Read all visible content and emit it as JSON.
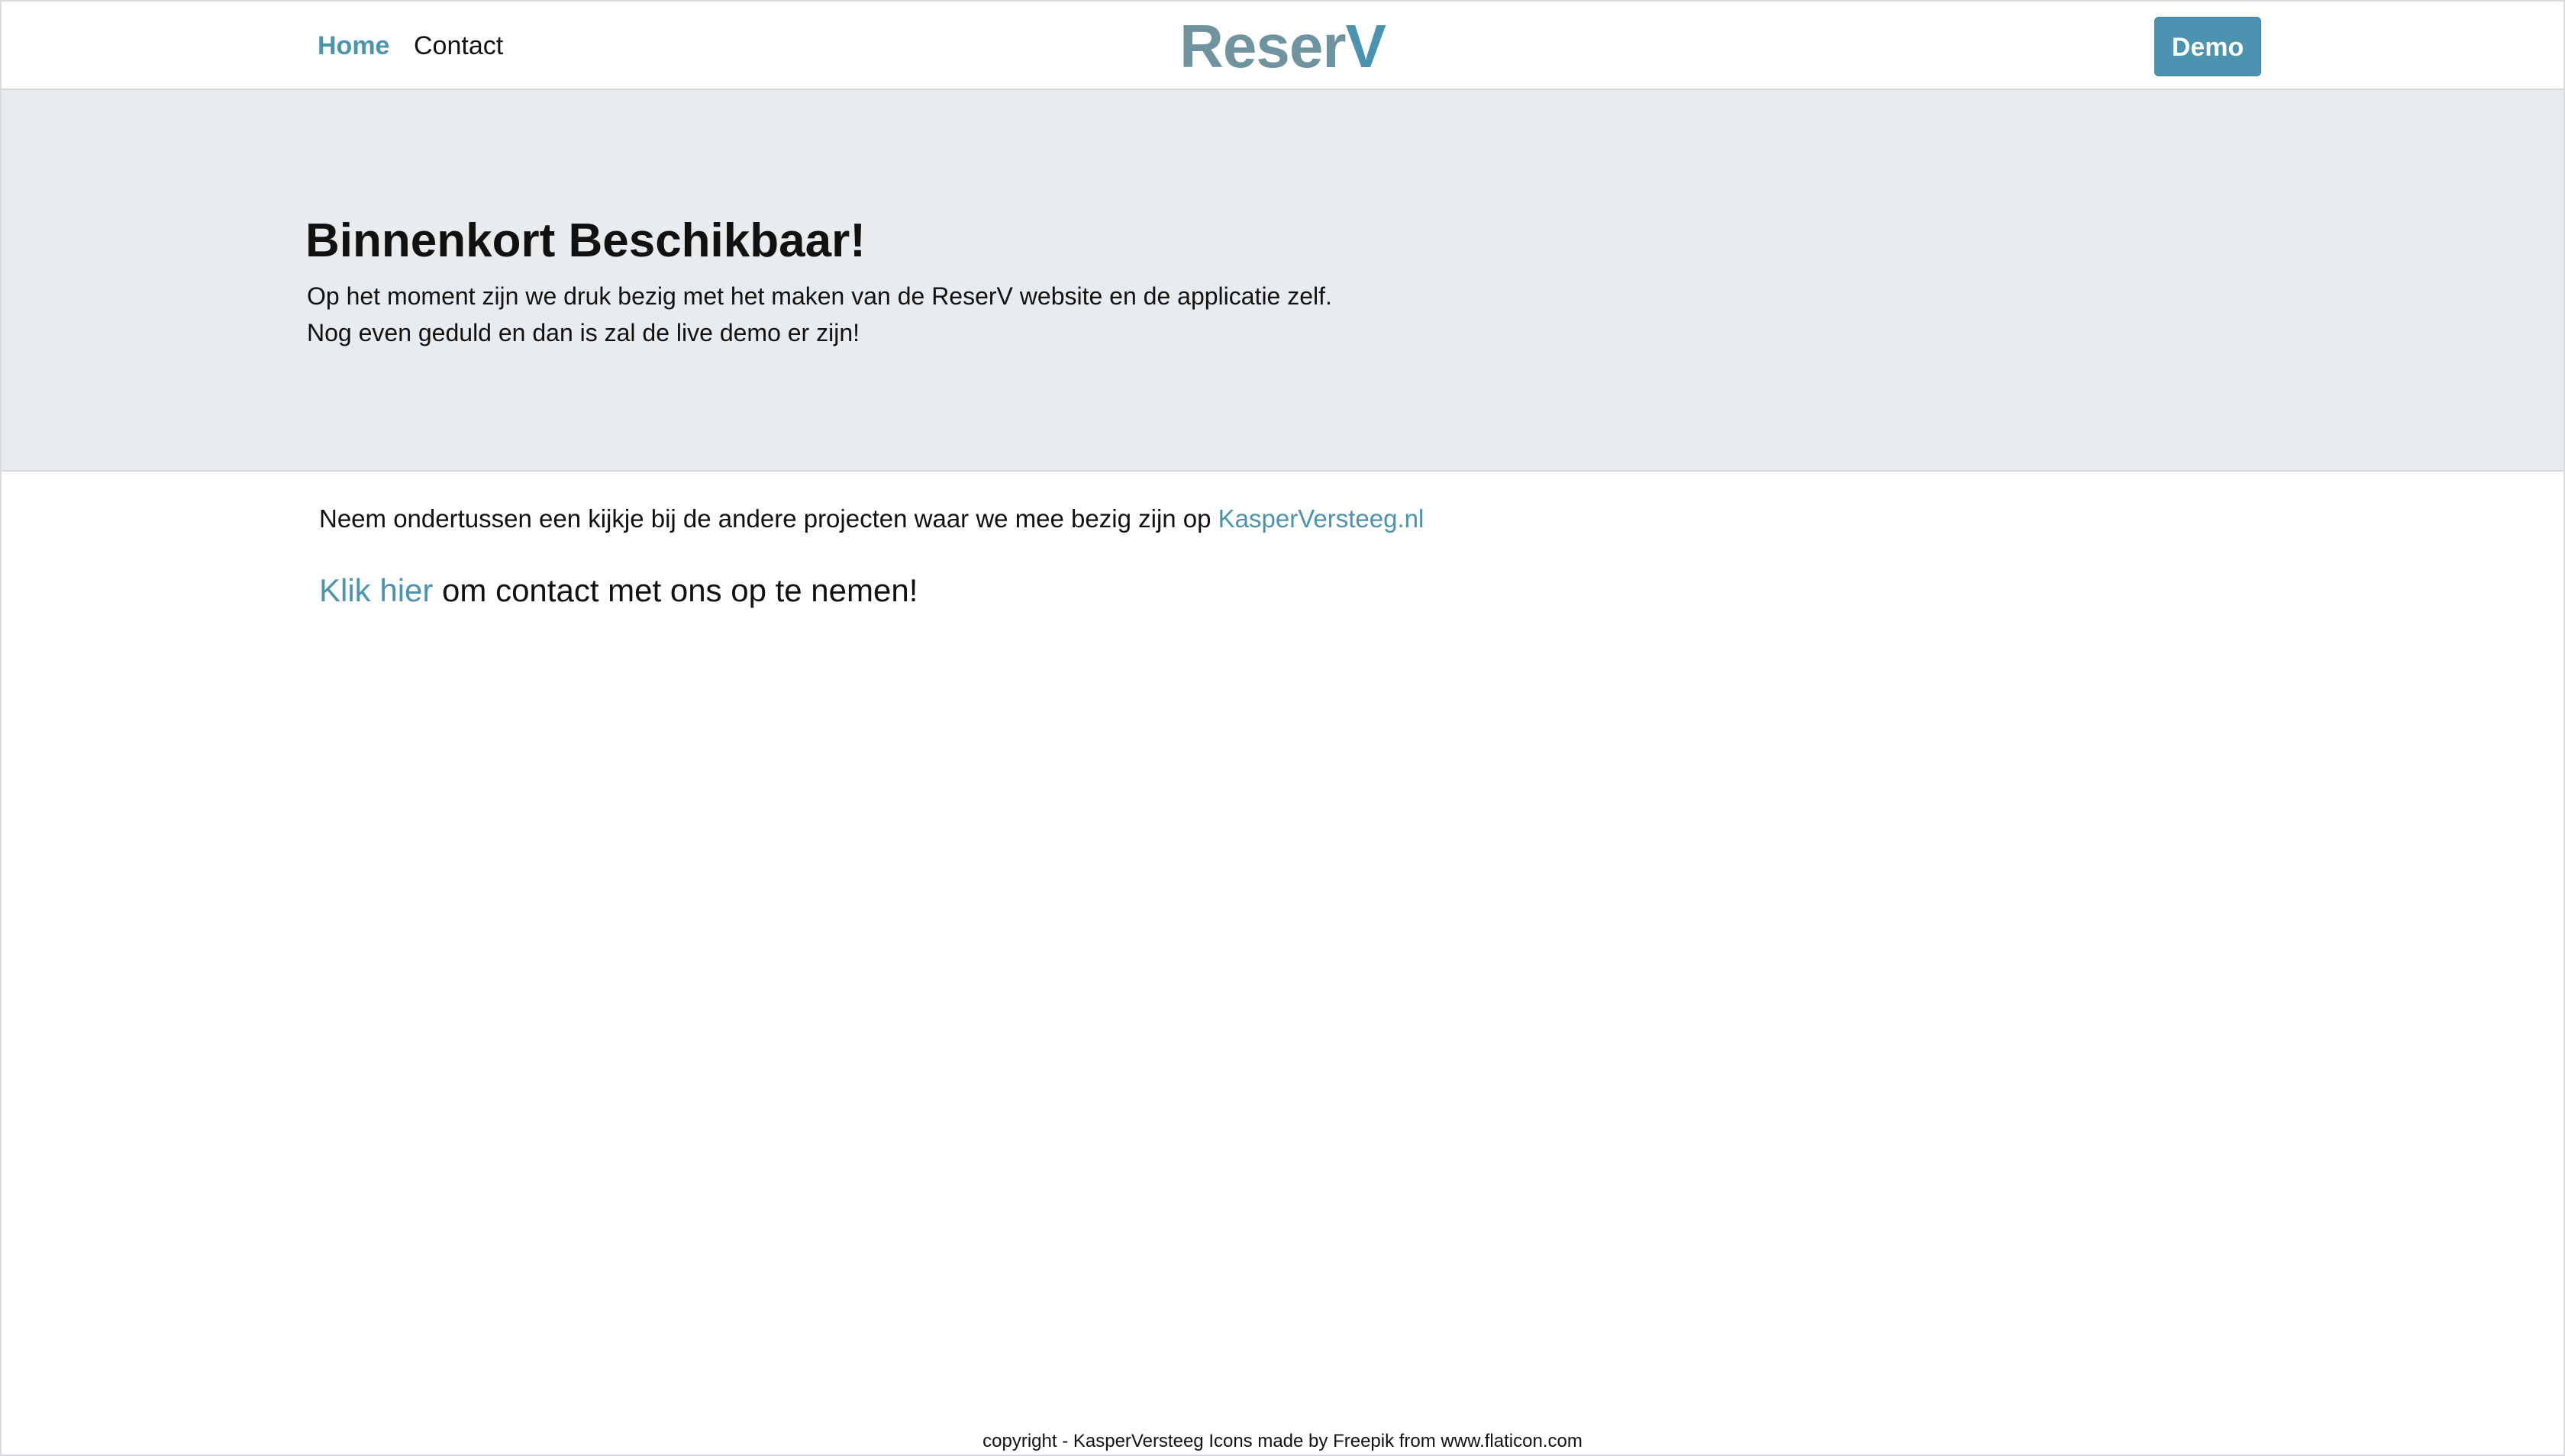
{
  "navbar": {
    "home_label": "Home",
    "contact_label": "Contact",
    "brand_main": "Reser",
    "brand_accent": "V",
    "demo_label": "Demo"
  },
  "jumbotron": {
    "title": "Binnenkort Beschikbaar!",
    "line_1": "Op het moment zijn we druk bezig met het maken van de ReserV website en de applicatie zelf.",
    "line_2": "Nog even geduld en dan is zal de live demo er zijn!"
  },
  "main": {
    "projects_text": "Neem ondertussen een kijkje bij de andere projecten waar we mee bezig zijn op ",
    "projects_link": "KasperVersteeg.nl",
    "contact_link": "Klik hier",
    "contact_text": " om contact met ons op te nemen!"
  },
  "footer": {
    "text": "copyright - KasperVersteeg Icons made by Freepik from www.flaticon.com"
  },
  "colors": {
    "accent": "#4b93b0",
    "brand_grey": "#6f939f",
    "jumbotron_bg": "#e9ecef",
    "text": "#111111"
  }
}
